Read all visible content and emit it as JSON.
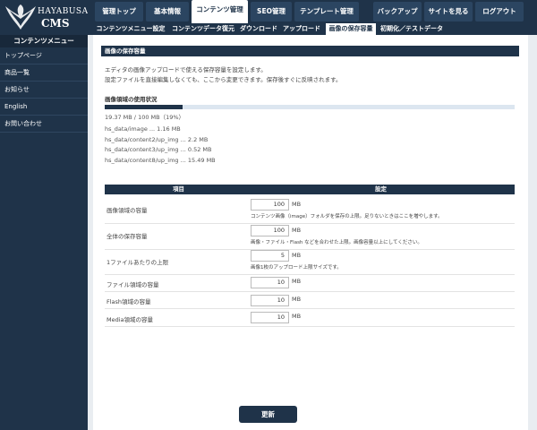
{
  "logo": {
    "line1": "HAYABUSA",
    "line2": "CMS"
  },
  "sidebar": {
    "title": "コンテンツメニュー",
    "items": [
      {
        "label": "トップページ"
      },
      {
        "label": "商品一覧"
      },
      {
        "label": "お知らせ"
      },
      {
        "label": "English"
      },
      {
        "label": "お問い合わせ"
      }
    ]
  },
  "topnav": {
    "left": [
      {
        "label": "管理トップ"
      },
      {
        "label": "基本情報"
      },
      {
        "label": "コンテンツ管理",
        "active": true
      },
      {
        "label": "SEO管理"
      },
      {
        "label": "テンプレート管理"
      }
    ],
    "right": [
      {
        "label": "バックアップ"
      },
      {
        "label": "サイトを見る"
      },
      {
        "label": "ログアウト"
      }
    ]
  },
  "subnav": {
    "items": [
      {
        "label": "コンテンツメニュー設定"
      },
      {
        "label": "コンテンツデータ復元"
      },
      {
        "label": "ダウンロード"
      },
      {
        "label": "アップロード"
      },
      {
        "label": "画像の保存容量",
        "active": true
      },
      {
        "label": "初期化／テストデータ"
      }
    ]
  },
  "page": {
    "section_title": "画像の保存容量",
    "desc_line1": "エディタの画像アップロードで使える保存容量を設定します。",
    "desc_line2": "設定ファイルを直接編集しなくても、ここから変更できます。保存後すぐに反映されます。",
    "usage_title": "画像領域の使用状況",
    "usage_percent": 19,
    "usage_text": "19.37 MB / 100 MB（19%）",
    "paths": [
      "hs_data/image ... 1.16 MB",
      "hs_data/content2/up_img ... 2.2 MB",
      "hs_data/content3/up_img ... 0.52 MB",
      "hs_data/content8/up_img ... 15.49 MB"
    ]
  },
  "settings": {
    "col_item": "項目",
    "col_setting": "設定",
    "rows": [
      {
        "label": "画像領域の容量",
        "value": "100",
        "unit": "MB",
        "note": "コンテンツ画像（image）フォルダを保存の上限。足りないときはここを増やします。"
      },
      {
        "label": "全体の保存容量",
        "value": "100",
        "unit": "MB",
        "note": "画像・ファイル・Flash などを合わせた上限。画像容量以上にしてください。"
      },
      {
        "label": "1ファイルあたりの上限",
        "value": "5",
        "unit": "MB",
        "note": "画像1枚のアップロード上限サイズです。"
      },
      {
        "label": "ファイル領域の容量",
        "value": "10",
        "unit": "MB",
        "note": ""
      },
      {
        "label": "Flash領域の容量",
        "value": "10",
        "unit": "MB",
        "note": ""
      },
      {
        "label": "Media領域の容量",
        "value": "10",
        "unit": "MB",
        "note": ""
      }
    ],
    "submit_label": "更新"
  }
}
